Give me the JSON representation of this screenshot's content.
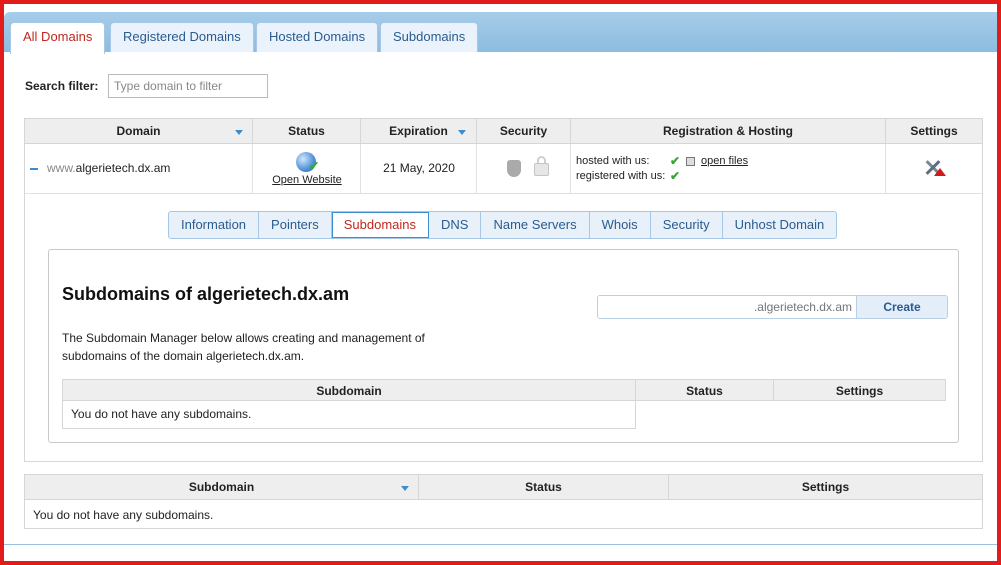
{
  "tabs": [
    {
      "label": "All Domains",
      "active": true
    },
    {
      "label": "Registered Domains",
      "active": false
    },
    {
      "label": "Hosted Domains",
      "active": false
    },
    {
      "label": "Subdomains",
      "active": false
    }
  ],
  "search": {
    "label": "Search filter:",
    "placeholder": "Type domain to filter",
    "value": ""
  },
  "domains_table": {
    "columns": [
      "Domain",
      "Status",
      "Expiration",
      "Security",
      "Registration & Hosting",
      "Settings"
    ],
    "row": {
      "prefix": "www.",
      "host": "algerietech.dx.am",
      "status_link": "Open Website",
      "expiration": "21 May, 2020",
      "hosted_label": "hosted with us:",
      "registered_label": "registered with us:",
      "open_files": "open files"
    }
  },
  "subtabs": [
    {
      "label": "Information",
      "active": false
    },
    {
      "label": "Pointers",
      "active": false
    },
    {
      "label": "Subdomains",
      "active": true
    },
    {
      "label": "DNS",
      "active": false
    },
    {
      "label": "Name Servers",
      "active": false
    },
    {
      "label": "Whois",
      "active": false
    },
    {
      "label": "Security",
      "active": false
    },
    {
      "label": "Unhost Domain",
      "active": false
    }
  ],
  "panel": {
    "title": "Subdomains of algerietech.dx.am",
    "description": "The Subdomain Manager below allows creating and management of subdomains of the domain algerietech.dx.am.",
    "create_suffix": ".algerietech.dx.am",
    "create_button": "Create",
    "columns": [
      "Subdomain",
      "Status",
      "Settings"
    ],
    "empty_text": "You do not have any subdomains."
  },
  "bottom_table": {
    "columns": [
      "Subdomain",
      "Status",
      "Settings"
    ],
    "empty_text": "You do not have any subdomains."
  },
  "colors": {
    "frame": "#e21b1b",
    "active_tab_text": "#c0281e",
    "link_blue": "#2a5b8e",
    "check_green": "#3aa53a"
  },
  "icons": [
    "globe-icon",
    "check-icon",
    "shield-icon",
    "lock-icon",
    "file-icon",
    "tools-icon",
    "sort-caret-icon"
  ]
}
